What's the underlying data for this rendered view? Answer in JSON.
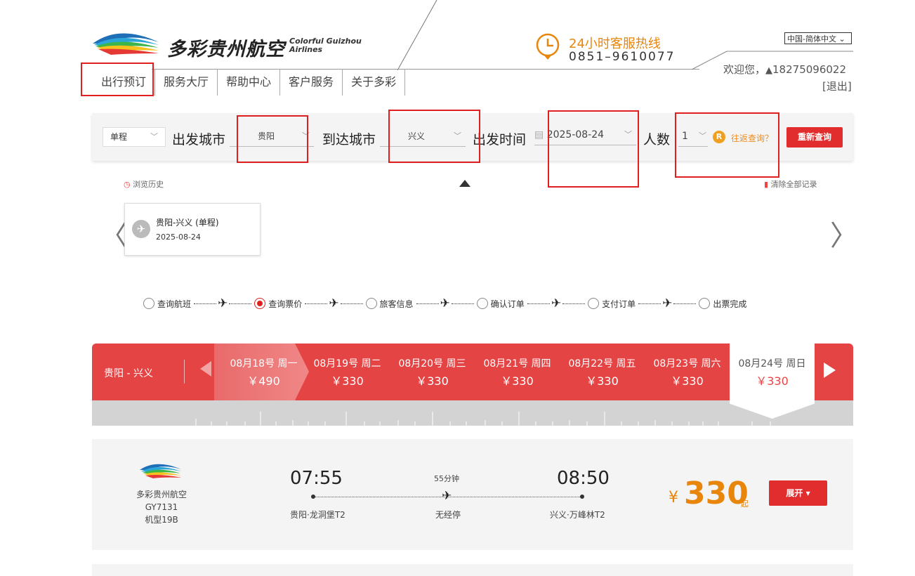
{
  "header": {
    "logo_cn": "多彩贵州航空",
    "logo_en_line1": "Colorful Guizhou",
    "logo_en_line2": "Airlines",
    "hotline_title": "24小时客服热线",
    "hotline_number": "0851–9610077",
    "language": "中国-简体中文",
    "welcome": "欢迎您，",
    "username": "18275096022",
    "logout": "[退出]"
  },
  "nav": [
    "出行预订",
    "服务大厅",
    "帮助中心",
    "客户服务",
    "关于多彩"
  ],
  "search": {
    "trip_type": "单程",
    "from_label": "出发城市",
    "from_value": "贵阳",
    "to_label": "到达城市",
    "to_value": "兴义",
    "date_label": "出发时间",
    "date_value": "2025-08-24",
    "pax_label": "人数",
    "pax_value": "1",
    "round_trip": "往返查询？",
    "requery": "重新查询"
  },
  "history": {
    "label": "浏览历史",
    "clear": "清除全部记录",
    "items": [
      {
        "route": "贵阳-兴义 (单程)",
        "date": "2025-08-24"
      }
    ]
  },
  "steps": [
    "查询航班",
    "查询票价",
    "旅客信息",
    "确认订单",
    "支付订单",
    "出票完成"
  ],
  "active_step": 1,
  "date_strip": {
    "route": "贵阳 - 兴义",
    "days": [
      {
        "date": "08月18号 周一",
        "price": "￥490"
      },
      {
        "date": "08月19号 周二",
        "price": "￥330"
      },
      {
        "date": "08月20号 周三",
        "price": "￥330"
      },
      {
        "date": "08月21号 周四",
        "price": "￥330"
      },
      {
        "date": "08月22号 周五",
        "price": "￥330"
      },
      {
        "date": "08月23号 周六",
        "price": "￥330"
      },
      {
        "date": "08月24号 周日",
        "price": "￥330"
      }
    ],
    "current_index": 6
  },
  "flight": {
    "airline": "多彩贵州航空",
    "flight_no": "GY7131",
    "aircraft": "机型19B",
    "dep_time": "07:55",
    "arr_time": "08:50",
    "duration": "55分钟",
    "stops": "无经停",
    "dep_airport": "贵阳·龙洞堡T2",
    "arr_airport": "兴义·万峰林T2",
    "price_symbol": "¥",
    "price": "330",
    "price_suffix": "起",
    "expand": "展开 ▾"
  },
  "colors": {
    "brand_red": "#e54444",
    "accent_orange": "#e8860c",
    "button_red": "#e12d2d"
  }
}
